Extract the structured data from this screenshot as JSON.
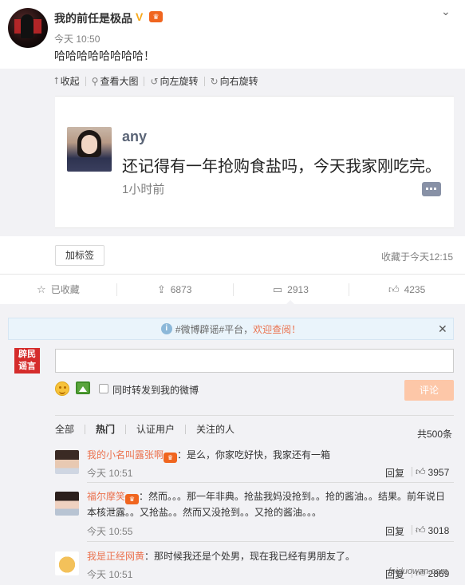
{
  "post": {
    "username": "我的前任是极品",
    "v_badge": "V",
    "time": "今天 10:50",
    "text": "哈哈哈哈哈哈哈哈！"
  },
  "media_toolbar": {
    "collapse": "收起",
    "view_large": "查看大图",
    "rotate_left": "向左旋转",
    "rotate_right": "向右旋转"
  },
  "embedded_card": {
    "name": "any",
    "text": "还记得有一年抢购食盐吗，今天我家刚吃完。",
    "time": "1小时前"
  },
  "tag_button": "加标签",
  "favorite_time": "收藏于今天12:15",
  "actions": {
    "favorited": "已收藏",
    "repost_count": "6873",
    "comment_count": "2913",
    "like_count": "4235"
  },
  "notice": {
    "text": "#微博辟谣#平台，",
    "link": "欢迎查阅！"
  },
  "composer": {
    "logo_text_1": "辟民",
    "logo_text_2": "谣言",
    "input_value": "",
    "sync_label": "同时转发到我的微博",
    "submit_label": "评论"
  },
  "filters": {
    "all": "全部",
    "hot": "热门",
    "verified": "认证用户",
    "following": "关注的人",
    "total": "共500条"
  },
  "comments": [
    {
      "name": "我的小名叫露张啊",
      "text": "：是么，你家吃好快，我家还有一箱",
      "time": "今天 10:51",
      "reply": "回复",
      "likes": "3957"
    },
    {
      "name": "福尔摩笑",
      "text": "：然而。。。那一年非典。抢盐我妈没抢到。。抢的酱油。。结果。前年说日本核泄露。。又抢盐。。然而又没抢到。。又抢的酱油。。。",
      "time": "今天 10:55",
      "reply": "回复",
      "likes": "3018"
    },
    {
      "name": "我是正经网黄",
      "text": "：那时候我还是个处男，现在我已经有男朋友了。",
      "time": "今天 10:51",
      "reply": "回复",
      "likes": "2869"
    }
  ],
  "watermark": "feiduowan.com",
  "icons": {
    "collapse": "arrow-up-icon",
    "view_large": "magnifier-icon",
    "rotate_left": "rotate-left-icon",
    "rotate_right": "rotate-right-icon",
    "favorite": "star-icon",
    "repost": "repost-icon",
    "comment": "comment-icon",
    "like": "thumbs-up-icon"
  },
  "colors": {
    "accent": "#eb7350",
    "link": "#eb7350",
    "background_gray": "#f2f2f5",
    "submit_disabled": "#fdc7a8"
  }
}
